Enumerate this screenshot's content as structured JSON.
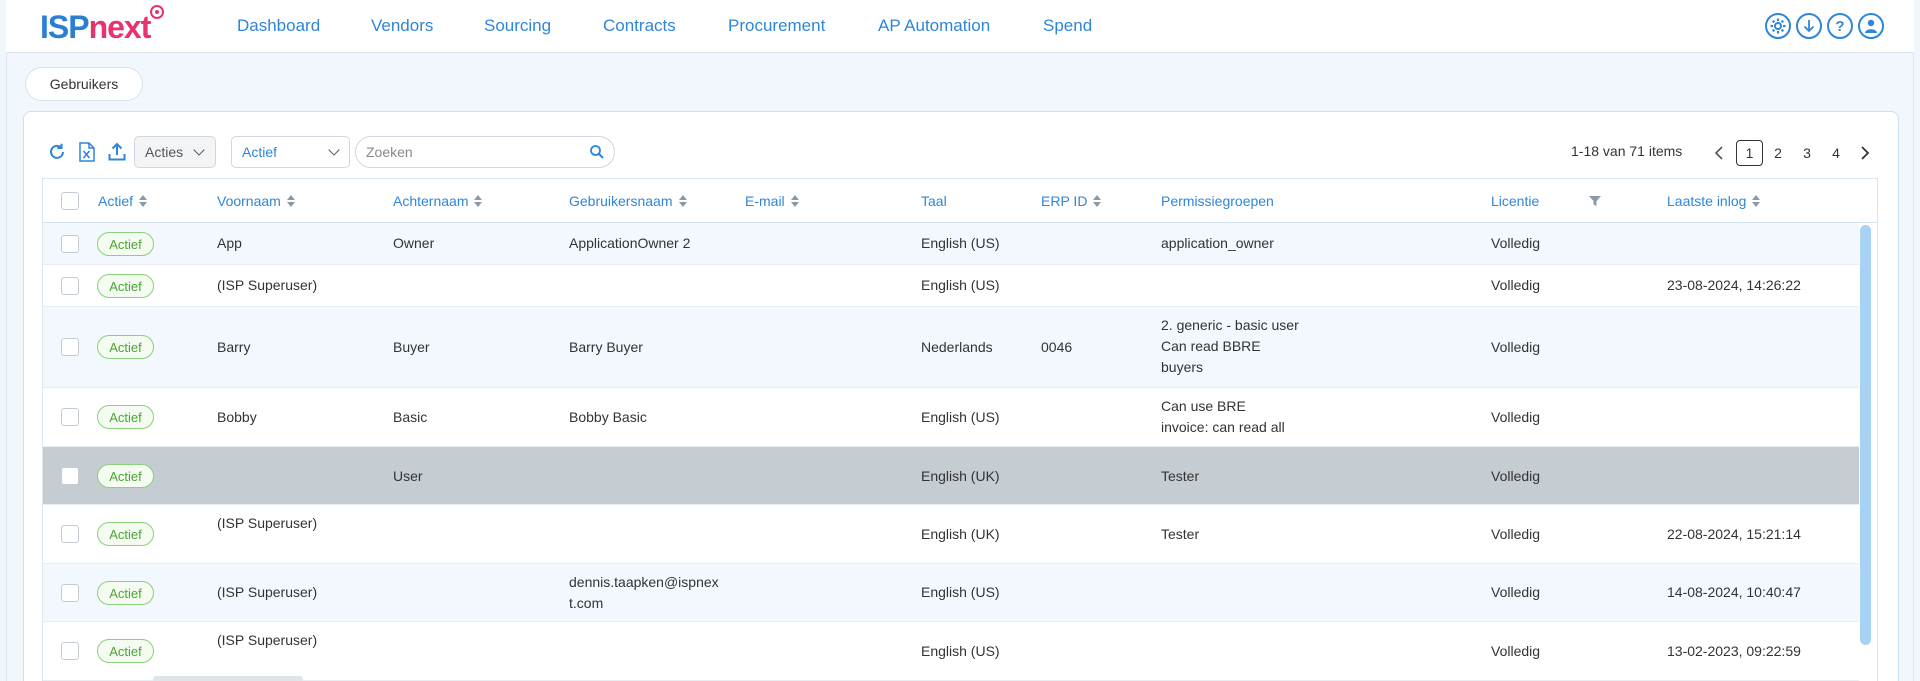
{
  "brand": {
    "part1": "ISP",
    "part2": "next"
  },
  "nav": [
    "Dashboard",
    "Vendors",
    "Sourcing",
    "Contracts",
    "Procurement",
    "AP Automation",
    "Spend"
  ],
  "tab": "Gebruikers",
  "toolbar": {
    "actions_label": "Acties",
    "status_value": "Actief",
    "search_placeholder": "Zoeken"
  },
  "pagination": {
    "info": "1-18 van 71 items",
    "pages": [
      "1",
      "2",
      "3",
      "4"
    ],
    "current": "1"
  },
  "columns": {
    "active": "Actief",
    "first_name": "Voornaam",
    "last_name": "Achternaam",
    "username": "Gebruikersnaam",
    "email": "E-mail",
    "language": "Taal",
    "erp_id": "ERP ID",
    "permissions": "Permissiegroepen",
    "license": "Licentie",
    "last_login": "Laatste inlog"
  },
  "rows": [
    {
      "status": "Actief",
      "first": "App",
      "last": "Owner",
      "user": "ApplicationOwner 2",
      "email": "",
      "lang": "English (US)",
      "erp": "",
      "perm": "application_owner",
      "lic": "Volledig",
      "login": ""
    },
    {
      "status": "Actief",
      "first": "(ISP Superuser)",
      "last": "",
      "user": "",
      "email": "",
      "lang": "English (US)",
      "erp": "",
      "perm": "",
      "lic": "Volledig",
      "login": "23-08-2024, 14:26:22"
    },
    {
      "status": "Actief",
      "first": "Barry",
      "last": "Buyer",
      "user": "Barry Buyer",
      "email": "",
      "lang": "Nederlands",
      "erp": "0046",
      "perm": "2. generic - basic user\nCan read BBRE\nbuyers",
      "lic": "Volledig",
      "login": ""
    },
    {
      "status": "Actief",
      "first": "Bobby",
      "last": "Basic",
      "user": "Bobby Basic",
      "email": "",
      "lang": "English (US)",
      "erp": "",
      "perm": "Can use BRE\ninvoice: can read all",
      "lic": "Volledig",
      "login": ""
    },
    {
      "status": "Actief",
      "first": "",
      "last": "User",
      "user": "",
      "email": "",
      "lang": "English (UK)",
      "erp": "",
      "perm": "Tester",
      "lic": "Volledig",
      "login": ""
    },
    {
      "status": "Actief",
      "first": "(ISP Superuser)",
      "last": "",
      "user": "",
      "email": "",
      "lang": "English (UK)",
      "erp": "",
      "perm": "Tester",
      "lic": "Volledig",
      "login": "22-08-2024, 15:21:14"
    },
    {
      "status": "Actief",
      "first": "(ISP Superuser)",
      "last": "",
      "user": "dennis.taapken@ispnex\nt.com",
      "email": "",
      "lang": "English (US)",
      "erp": "",
      "perm": "",
      "lic": "Volledig",
      "login": "14-08-2024, 10:40:47"
    },
    {
      "status": "Actief",
      "first": "(ISP Superuser)",
      "last": "",
      "user": "",
      "email": "",
      "lang": "English (US)",
      "erp": "",
      "perm": "",
      "lic": "Volledig",
      "login": "13-02-2023, 09:22:59"
    }
  ]
}
